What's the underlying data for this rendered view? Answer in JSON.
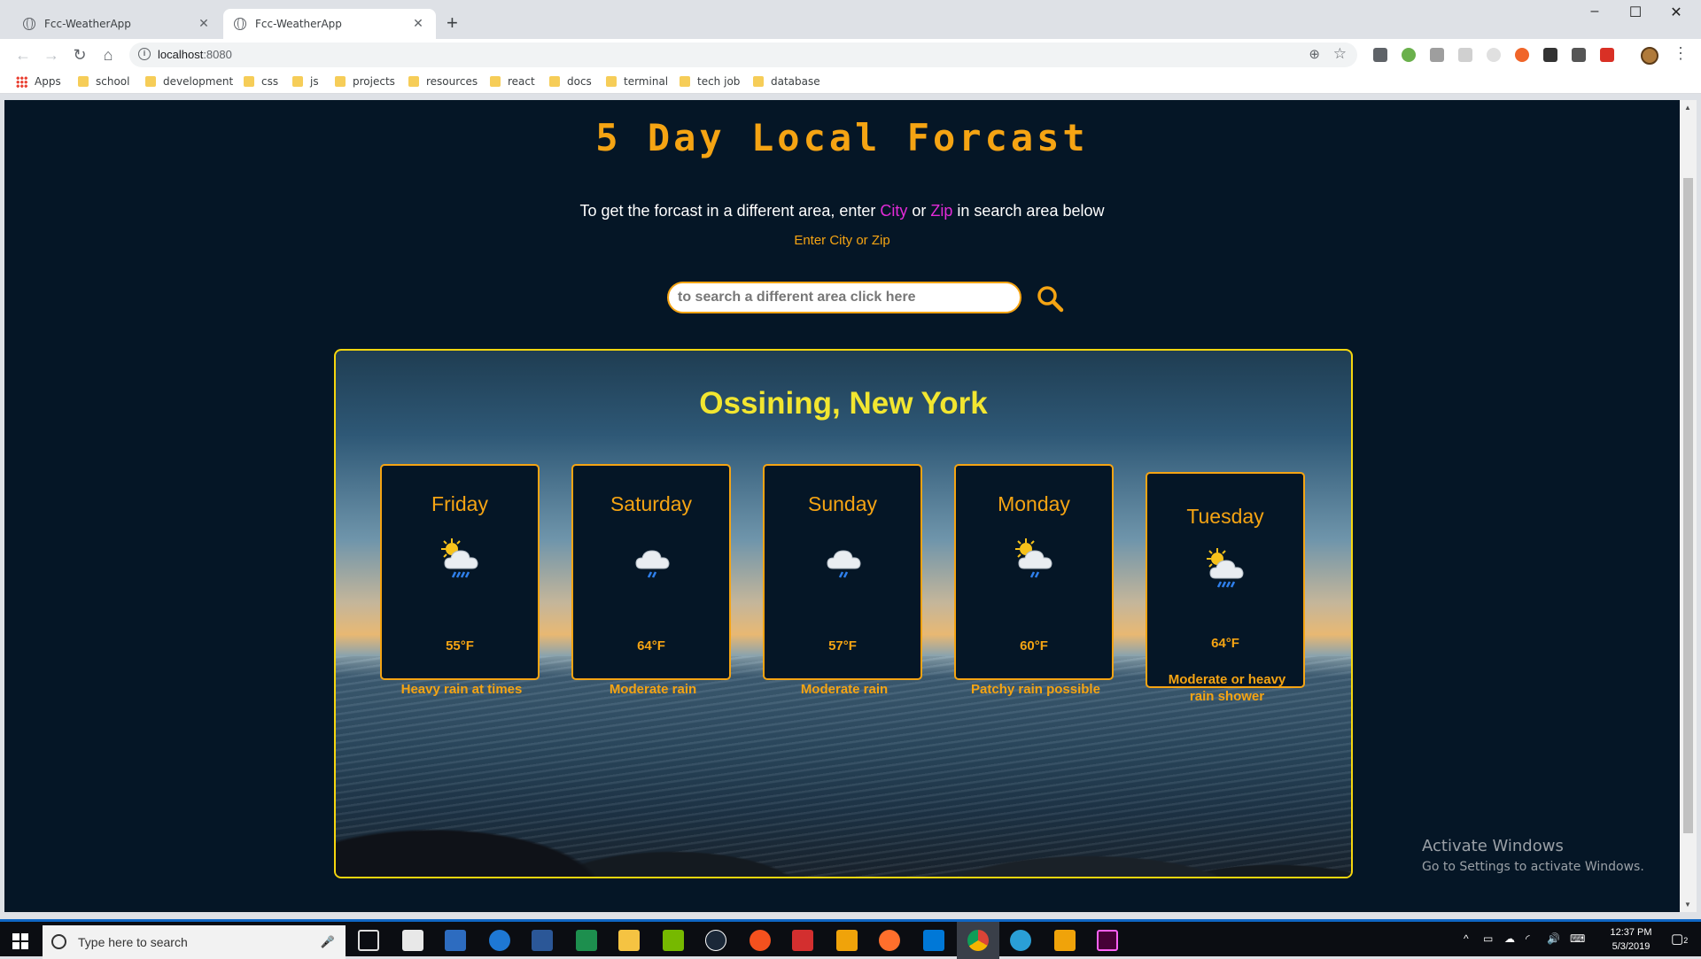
{
  "browser": {
    "tabs": [
      {
        "title": "Fcc-WeatherApp",
        "active": false
      },
      {
        "title": "Fcc-WeatherApp",
        "active": true
      }
    ],
    "url": "localhost",
    "url_port": ":8080",
    "bookmarks": [
      "Apps",
      "school",
      "development",
      "css",
      "js",
      "projects",
      "resources",
      "react",
      "docs",
      "terminal",
      "tech job",
      "database"
    ]
  },
  "page": {
    "title": "5 Day Local Forcast",
    "instructions_before": "To get the forcast in a different area, enter ",
    "city_word": "City",
    "or_word": " or ",
    "zip_word": "Zip",
    "instructions_after": " in search area below",
    "enter_label": "Enter City or Zip",
    "search_placeholder": "to search a different area click here",
    "location": "Ossining, New York",
    "forecast": [
      {
        "day": "Friday",
        "icon": "sun-cloud-heavy-rain-icon",
        "temp": "55°F",
        "condition": "Heavy rain at times"
      },
      {
        "day": "Saturday",
        "icon": "cloud-rain-icon",
        "temp": "64°F",
        "condition": "Moderate rain"
      },
      {
        "day": "Sunday",
        "icon": "cloud-rain-icon",
        "temp": "57°F",
        "condition": "Moderate rain"
      },
      {
        "day": "Monday",
        "icon": "sun-cloud-rain-icon",
        "temp": "60°F",
        "condition": "Patchy rain possible"
      },
      {
        "day": "Tuesday",
        "icon": "sun-cloud-heavy-rain-icon",
        "temp": "64°F",
        "condition": "Moderate or heavy rain shower"
      }
    ]
  },
  "windows": {
    "activate_title": "Activate Windows",
    "activate_sub": "Go to Settings to activate Windows.",
    "taskbar_search": "Type here to search",
    "time": "12:37 PM",
    "date": "5/3/2019",
    "notification_count": "2"
  },
  "colors": {
    "accent": "#f5a413",
    "highlight": "#e32bd8",
    "location": "#f2e630",
    "background": "#051626"
  }
}
